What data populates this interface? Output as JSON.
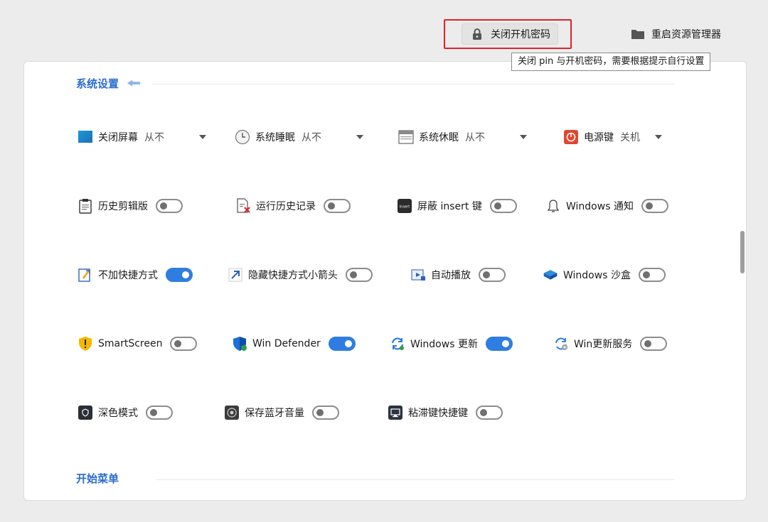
{
  "topbar": {
    "lock_button": "关闭开机密码",
    "folder_button": "重启资源管理器",
    "tooltip": "关闭 pin 与开机密码，需要根据提示自行设置"
  },
  "sections": {
    "system": "系统设置",
    "start": "开始菜单"
  },
  "dropdowns": [
    {
      "label": "关闭屏幕",
      "value": "从不",
      "icon": "screen-icon"
    },
    {
      "label": "系统睡眠",
      "value": "从不",
      "icon": "clock-icon"
    },
    {
      "label": "系统休眠",
      "value": "从不",
      "icon": "hibernate-icon"
    },
    {
      "label": "电源键",
      "value": "关机",
      "icon": "power-icon"
    }
  ],
  "toggles": [
    {
      "label": "历史剪辑版",
      "on": false,
      "icon": "clipboard-icon"
    },
    {
      "label": "运行历史记录",
      "on": false,
      "icon": "run-history-icon"
    },
    {
      "label": "屏蔽 insert 键",
      "on": false,
      "icon": "insert-key-icon",
      "badge": "Insert"
    },
    {
      "label": "Windows 通知",
      "on": false,
      "icon": "bell-icon"
    },
    {
      "label": "不加快捷方式",
      "on": true,
      "icon": "shortcut-icon"
    },
    {
      "label": "隐藏快捷方式小箭头",
      "on": false,
      "icon": "arrow-icon"
    },
    {
      "label": "自动播放",
      "on": false,
      "icon": "autoplay-icon"
    },
    {
      "label": "Windows 沙盒",
      "on": false,
      "icon": "sandbox-icon"
    },
    {
      "label": "SmartScreen",
      "on": false,
      "icon": "shield-warning-icon"
    },
    {
      "label": "Win Defender",
      "on": true,
      "icon": "defender-icon"
    },
    {
      "label": "Windows 更新",
      "on": true,
      "icon": "update-icon"
    },
    {
      "label": "Win更新服务",
      "on": false,
      "icon": "update-service-icon"
    },
    {
      "label": "深色模式",
      "on": false,
      "icon": "dark-mode-icon"
    },
    {
      "label": "保存蓝牙音量",
      "on": false,
      "icon": "bluetooth-volume-icon"
    },
    {
      "label": "粘滞键快捷键",
      "on": false,
      "icon": "sticky-keys-icon"
    }
  ],
  "colors": {
    "accent": "#2f7de1",
    "section_title": "#2a6bd1",
    "highlight": "#e0212b"
  }
}
